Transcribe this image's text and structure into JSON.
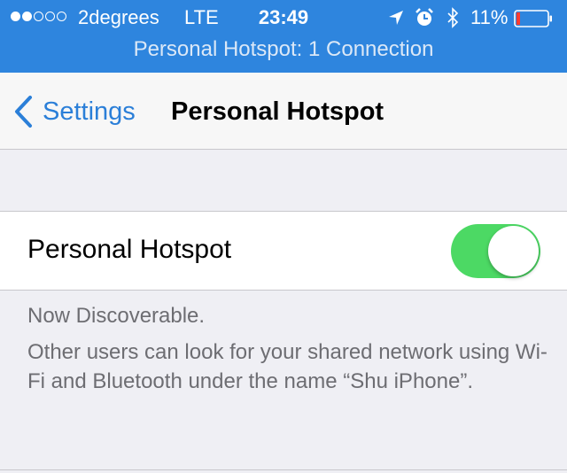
{
  "status_bar": {
    "signal_bars_filled": 2,
    "signal_bars_total": 5,
    "carrier": "2degrees",
    "network": "LTE",
    "time": "23:49",
    "icons": [
      "location-arrow-icon",
      "alarm-icon",
      "bluetooth-icon"
    ],
    "battery_percent": "11%",
    "battery_level": 0.11,
    "battery_color": "#ff3b30",
    "background_color": "#2e85de"
  },
  "banner": {
    "text": "Personal Hotspot: 1 Connection"
  },
  "nav": {
    "back_label": "Settings",
    "title": "Personal Hotspot",
    "accent_color": "#2b7fd8"
  },
  "hotspot": {
    "label": "Personal Hotspot",
    "enabled": true,
    "toggle_color": "#4cd964"
  },
  "footer": {
    "line1": "Now Discoverable.",
    "line2": "Other users can look for your shared network using Wi-Fi and Bluetooth under the name “Shu iPhone”."
  }
}
